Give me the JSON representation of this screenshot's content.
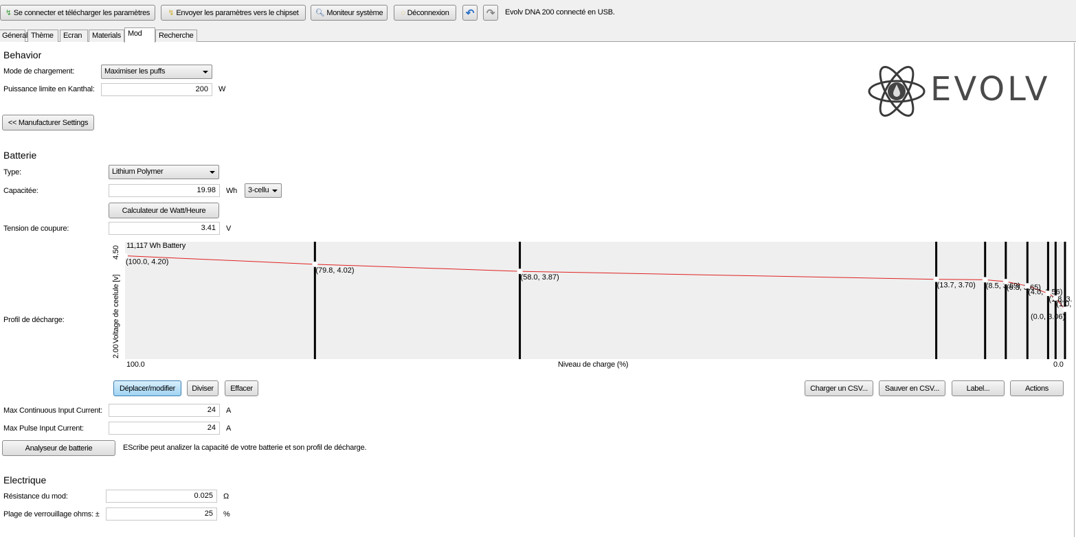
{
  "toolbar": {
    "connect": "Se connecter et télécharger les paramètres",
    "send": "Envoyer les paramètres vers le chipset",
    "monitor": "Moniteur système",
    "disconnect": "Déconnexion",
    "status": "Evolv DNA 200 connecté en USB."
  },
  "tabs": [
    "Géneral",
    "Thème",
    "Ecran",
    "Materials",
    "Mod",
    "Recherche"
  ],
  "behavior": {
    "title": "Behavior",
    "mode_label": "Mode de chargement:",
    "mode_value": "Maximiser les puffs",
    "power_label": "Puissance limite en Kanthal:",
    "power_value": "200",
    "power_unit": "W",
    "manufacturer_button": "<< Manufacturer Settings"
  },
  "logo": {
    "text": "EVOLV"
  },
  "battery": {
    "title": "Batterie",
    "type_label": "Type:",
    "type_value": "Lithium Polymer",
    "capacity_label": "Capacitée:",
    "capacity_value": "19.98",
    "capacity_unit": "Wh",
    "cells_value": "3-cellu",
    "calc_button": "Calculateur de Watt/Heure",
    "cutoff_label": "Tension de coupure:",
    "cutoff_value": "3.41",
    "cutoff_unit": "V",
    "profile_label": "Profil de décharge:",
    "buttons": {
      "move": "Déplacer/modifier",
      "split": "Diviser",
      "clear": "Effacer",
      "load_csv": "Charger un CSV...",
      "save_csv": "Sauver en CSV...",
      "label": "Label...",
      "actions": "Actions"
    },
    "max_cont_label": "Max Continuous Input Current:",
    "max_cont_value": "24",
    "max_pulse_label": "Max Pulse Input Current:",
    "max_pulse_value": "24",
    "current_unit": "A",
    "analyzer_button": "Analyseur de batterie",
    "analyzer_text": "EScribe peut analizer la capacité de votre batterie et son profil de décharge."
  },
  "electrique": {
    "title": "Electrique",
    "res_label": "Résistance du mod:",
    "res_value": "0.025",
    "res_unit": "Ω",
    "lock_label": "Plage de verrouillage ohms: ±",
    "lock_value": "25",
    "lock_unit": "%"
  },
  "chart_data": {
    "type": "line",
    "title": "11,117 Wh Battery",
    "xlabel": "Niveau de charge (%)",
    "ylabel": "Voltage de ceelule [v]",
    "xlim": [
      100,
      0
    ],
    "ylim": [
      2.0,
      4.5
    ],
    "x_ticks": [
      "100.0",
      "0.0"
    ],
    "y_ticks": [
      "2.00",
      "4.50"
    ],
    "line_color": "#e02020",
    "grid": false,
    "points": [
      [
        100.0,
        4.2
      ],
      [
        79.8,
        4.02
      ],
      [
        58.0,
        3.87
      ],
      [
        13.7,
        3.7
      ],
      [
        8.5,
        3.69
      ],
      [
        6.3,
        3.65
      ],
      [
        4.0,
        3.56
      ],
      [
        1.8,
        3.4
      ],
      [
        1.0,
        3.3
      ],
      [
        0.0,
        3.06
      ]
    ]
  }
}
